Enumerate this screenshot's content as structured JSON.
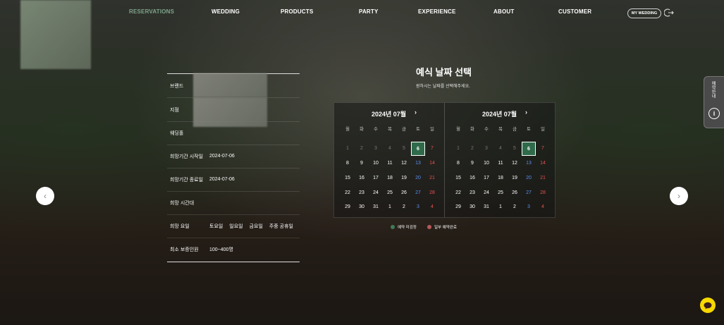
{
  "nav": {
    "items": [
      "RESERVATIONS",
      "WEDDING",
      "PRODUCTS",
      "PARTY",
      "EXPERIENCE",
      "ABOUT",
      "CUSTOMER"
    ],
    "my_wedding": "MY WEDDING"
  },
  "info": {
    "rows": [
      {
        "label": "브랜드",
        "value": ""
      },
      {
        "label": "지점",
        "value": ""
      },
      {
        "label": "웨딩홀",
        "value": ""
      },
      {
        "label": "희망기간 시작일",
        "value": "2024-07-06"
      },
      {
        "label": "희망기간 종료일",
        "value": "2024-07-06"
      },
      {
        "label": "희망 시간대",
        "value": ""
      },
      {
        "label": "희망 요일",
        "value": ""
      },
      {
        "label": "최소 보증인원",
        "value": "100~400명"
      }
    ],
    "weekdays": [
      "토요일",
      "일요일",
      "금요일",
      "주중 공휴일"
    ]
  },
  "main": {
    "title": "예식 날짜 선택",
    "subtitle": "원하시는 날짜를 선택해주세요."
  },
  "calendar": {
    "months": [
      "2024년 07월",
      "2024년 07월"
    ],
    "next": "›",
    "dow": [
      "월",
      "화",
      "수",
      "목",
      "금",
      "토",
      "일"
    ],
    "weeks": [
      [
        "1",
        "2",
        "3",
        "4",
        "5",
        "6",
        "7"
      ],
      [
        "8",
        "9",
        "10",
        "11",
        "12",
        "13",
        "14"
      ],
      [
        "15",
        "16",
        "17",
        "18",
        "19",
        "20",
        "21"
      ],
      [
        "22",
        "23",
        "24",
        "25",
        "26",
        "27",
        "28"
      ],
      [
        "29",
        "30",
        "31",
        "1",
        "2",
        "3",
        "4"
      ]
    ],
    "selected": "6"
  },
  "legend": {
    "available": "예약 미검정",
    "partial": "일부 예약완료",
    "available_color": "#3f7a57",
    "partial_color": "#b55a5a"
  },
  "side_tab": {
    "label": "예약안내"
  },
  "arrows": {
    "prev": "‹",
    "next": "›"
  },
  "colors": {
    "accent": "#2f6b4a",
    "sat": "#5b8ff0",
    "sun": "#e35050"
  }
}
